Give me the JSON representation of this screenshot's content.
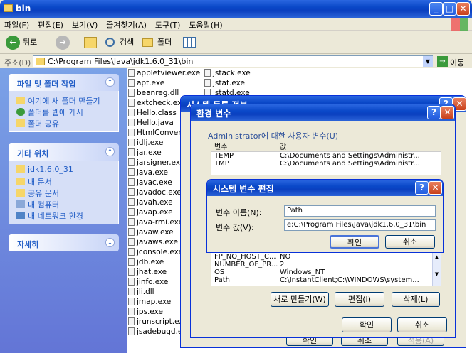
{
  "window": {
    "title": "bin"
  },
  "menu": [
    "파일(F)",
    "편집(E)",
    "보기(V)",
    "즐겨찾기(A)",
    "도구(T)",
    "도움말(H)"
  ],
  "toolbar": {
    "back": "뒤로",
    "search": "검색",
    "folders": "폴더"
  },
  "address": {
    "label": "주소(D)",
    "path": "C:\\Program Files\\Java\\jdk1.6.0_31\\bin",
    "go": "이동"
  },
  "left": {
    "tasks_title": "파일 및 폴더 작업",
    "tasks": [
      "여기에 새 폴더 만들기",
      "폴더를 웹에 게시",
      "폴더 공유"
    ],
    "places_title": "기타 위치",
    "places": [
      "jdk1.6.0_31",
      "내 문서",
      "공유 문서",
      "내 컴퓨터",
      "내 네트워크 환경"
    ],
    "details_title": "자세히"
  },
  "files_col1": [
    "appletviewer.exe",
    "apt.exe",
    "beanreg.dll",
    "extcheck.exe",
    "Hello.class",
    "Hello.java",
    "HtmlConverte",
    "idlj.exe",
    "jar.exe",
    "jarsigner.exe",
    "java.exe",
    "javac.exe",
    "javadoc.exe",
    "javah.exe",
    "javap.exe",
    "java-rmi.exe",
    "javaw.exe",
    "javaws.exe",
    "jconsole.exe",
    "jdb.exe",
    "jhat.exe",
    "jinfo.exe",
    "jli.dll",
    "jmap.exe",
    "jps.exe",
    "jrunscript.exe",
    "jsadebugd.exe"
  ],
  "files_col2": [
    "jstack.exe",
    "jstat.exe",
    "jstatd.exe"
  ],
  "sysprops": {
    "title": "시스템 등록 정보",
    "ok": "확인",
    "cancel": "취소",
    "apply": "적용(A)"
  },
  "envvars": {
    "title": "환경 변수",
    "user_label": "Administrator에 대한 사용자 변수(U)",
    "col_var": "변수",
    "col_val": "값",
    "user_rows": [
      {
        "var": "TEMP",
        "val": "C:\\Documents and Settings\\Administr..."
      },
      {
        "var": "TMP",
        "val": "C:\\Documents and Settings\\Administr..."
      }
    ],
    "sys_rows": [
      {
        "var": "FP_NO_HOST_C...",
        "val": "NO"
      },
      {
        "var": "NUMBER_OF_PR...",
        "val": "2"
      },
      {
        "var": "OS",
        "val": "Windows_NT"
      },
      {
        "var": "Path",
        "val": "C:\\InstantClient;C:\\WINDOWS\\system..."
      }
    ],
    "new": "새로 만들기(W)",
    "edit": "편집(I)",
    "delete": "삭제(L)",
    "ok": "확인",
    "cancel": "취소"
  },
  "editvar": {
    "title": "시스템 변수 편집",
    "name_label": "변수 이름(N):",
    "name_value": "Path",
    "value_label": "변수 값(V):",
    "value_value": "e;C:\\Program Files\\Java\\jdk1.6.0_31\\bin",
    "ok": "확인",
    "cancel": "취소"
  }
}
